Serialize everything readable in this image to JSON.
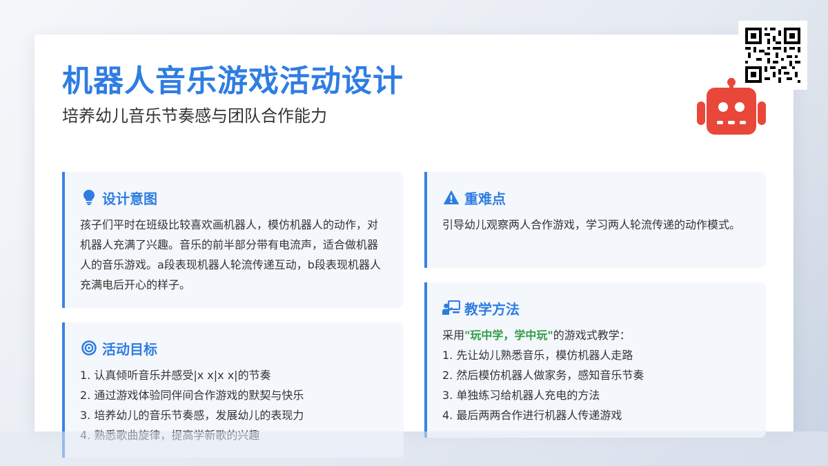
{
  "header": {
    "title": "机器人音乐游戏活动设计",
    "subtitle": "培养幼儿音乐节奏感与团队合作能力"
  },
  "icons": {
    "qr": "qr-code-icon",
    "robot": "robot-icon",
    "design": "lightbulb-icon",
    "goals": "target-icon",
    "key_points": "warning-icon",
    "methods": "teacher-board-icon"
  },
  "colors": {
    "accent": "#2f7de1",
    "panel_bg": "#f4f7fc",
    "robot": "#e8473a",
    "highlight": "#2e9d45",
    "text": "#333333"
  },
  "design_intent": {
    "heading": "设计意图",
    "body": "孩子们平时在班级比较喜欢画机器人，模仿机器人的动作，对机器人充满了兴趣。音乐的前半部分带有电流声，适合做机器人的音乐游戏。a段表现机器人轮流传递互动，b段表现机器人充满电后开心的样子。"
  },
  "goals": {
    "heading": "活动目标",
    "items": [
      "1. 认真倾听音乐并感受|x x|x x|的节奏",
      "2. 通过游戏体验同伴间合作游戏的默契与快乐",
      "3. 培养幼儿的音乐节奏感，发展幼儿的表现力",
      "4. 熟悉歌曲旋律，提高学新歌的兴趣"
    ]
  },
  "key_points": {
    "heading": "重难点",
    "body": "引导幼儿观察两人合作游戏，学习两人轮流传递的动作模式。"
  },
  "methods": {
    "heading": "教学方法",
    "intro_prefix": "采用",
    "intro_highlight": "\"玩中学，学中玩\"",
    "intro_suffix": "的游戏式教学：",
    "items": [
      "1. 先让幼儿熟悉音乐，模仿机器人走路",
      "2. 然后模仿机器人做家务，感知音乐节奏",
      "3. 单独练习给机器人充电的方法",
      "4. 最后两两合作进行机器人传递游戏"
    ]
  }
}
